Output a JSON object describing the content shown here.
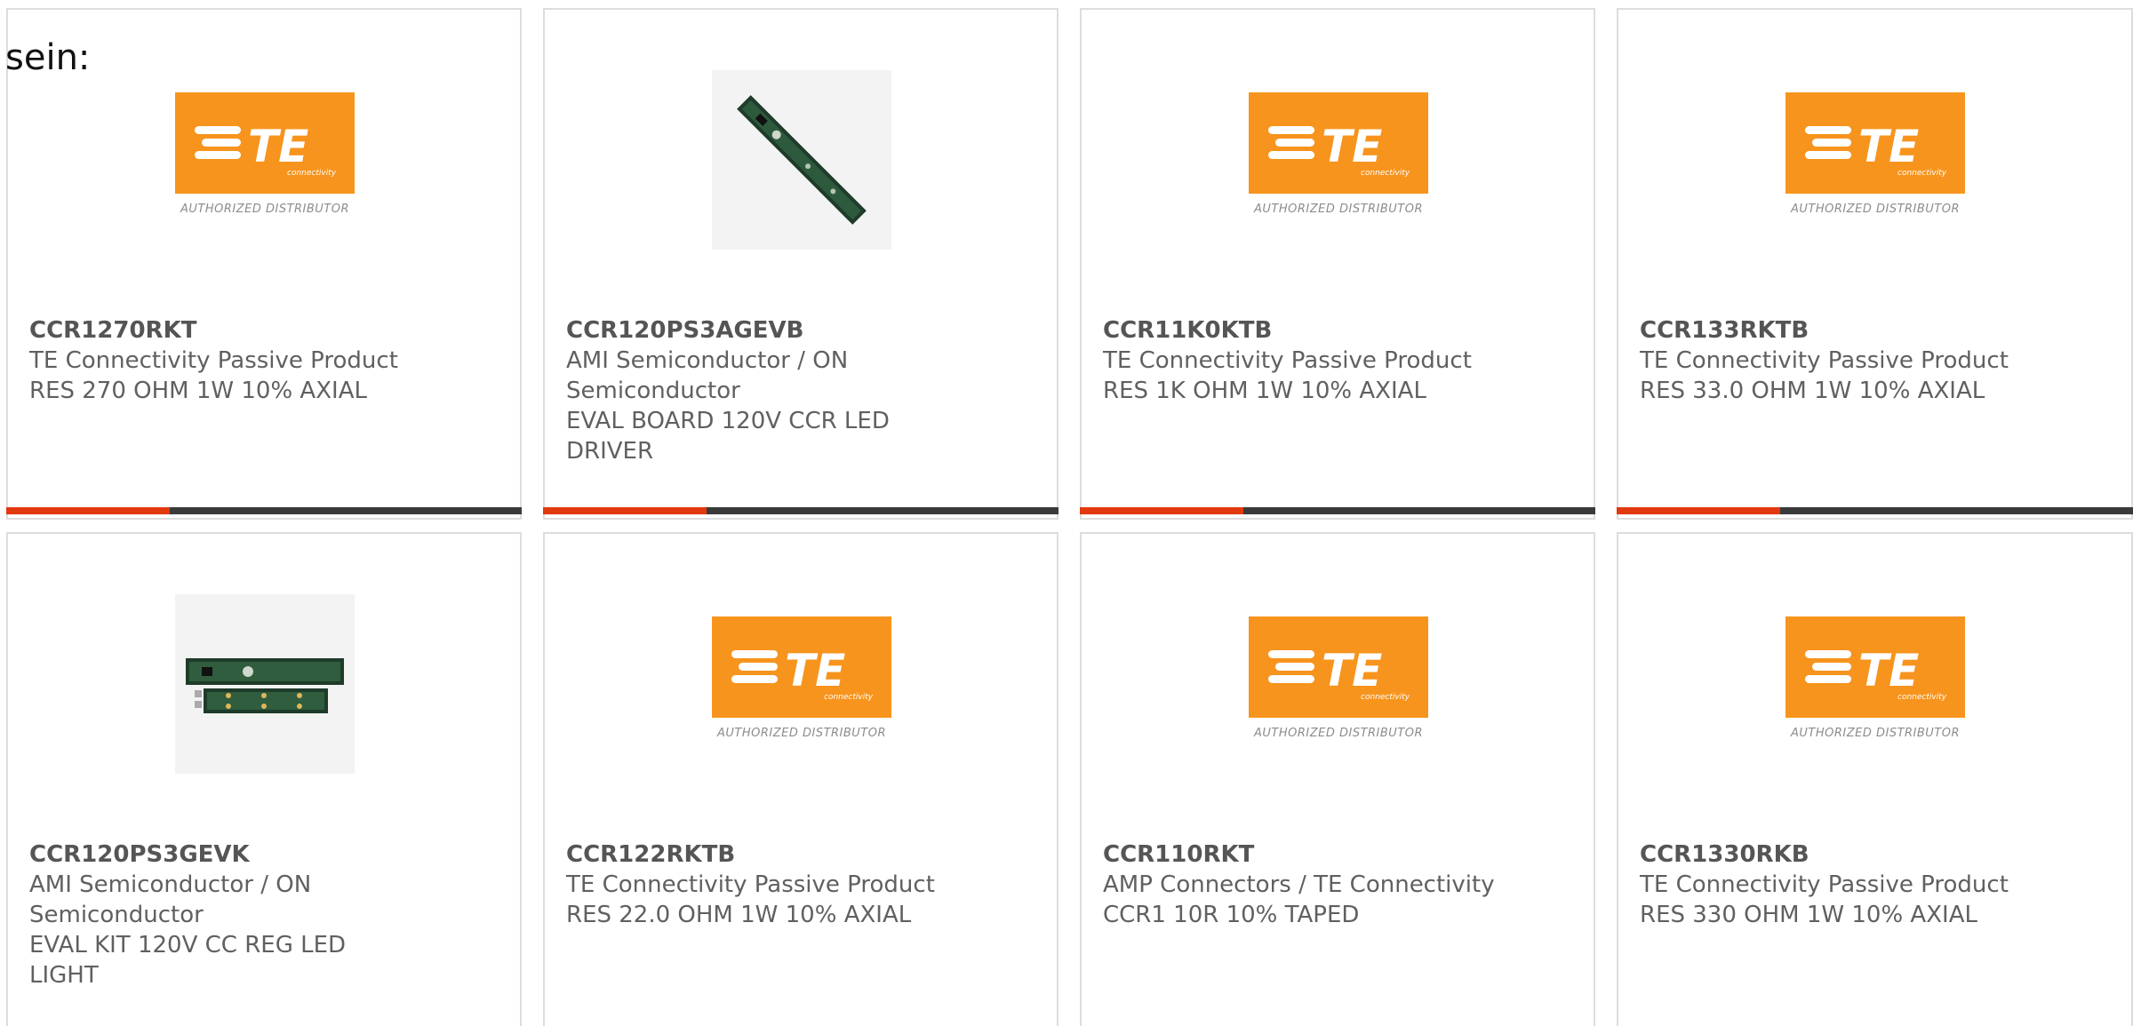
{
  "intro_text": "sein:",
  "logo": {
    "brand": "TE",
    "tagline": "connectivity",
    "distributor": "AUTHORIZED DISTRIBUTOR",
    "color": "#f7941d"
  },
  "accent_color": "#e2390f",
  "products": [
    {
      "part": "CCR1270RKT",
      "maker": "TE Connectivity Passive Product",
      "desc": "RES 270 OHM 1W 10% AXIAL",
      "image": "te-logo"
    },
    {
      "part": "CCR120PS3AGEVB",
      "maker": "AMI Semiconductor / ON Semiconductor",
      "desc": "EVAL BOARD 120V CCR LED DRIVER",
      "image": "board-diagonal"
    },
    {
      "part": "CCR11K0KTB",
      "maker": "TE Connectivity Passive Product",
      "desc": "RES 1K OHM 1W 10% AXIAL",
      "image": "te-logo"
    },
    {
      "part": "CCR133RKTB",
      "maker": "TE Connectivity Passive Product",
      "desc": "RES 33.0 OHM 1W 10% AXIAL",
      "image": "te-logo"
    },
    {
      "part": "CCR120PS3GEVK",
      "maker": "AMI Semiconductor / ON Semiconductor",
      "desc": "EVAL KIT 120V CC REG LED LIGHT",
      "image": "board-kit"
    },
    {
      "part": "CCR122RKTB",
      "maker": "TE Connectivity Passive Product",
      "desc": "RES 22.0 OHM 1W 10% AXIAL",
      "image": "te-logo"
    },
    {
      "part": "CCR110RKT",
      "maker": "AMP Connectors / TE Connectivity",
      "desc": "CCR1 10R 10% TAPED",
      "image": "te-logo"
    },
    {
      "part": "CCR1330RKB",
      "maker": "TE Connectivity Passive Product",
      "desc": "RES 330 OHM 1W 10% AXIAL",
      "image": "te-logo"
    }
  ]
}
